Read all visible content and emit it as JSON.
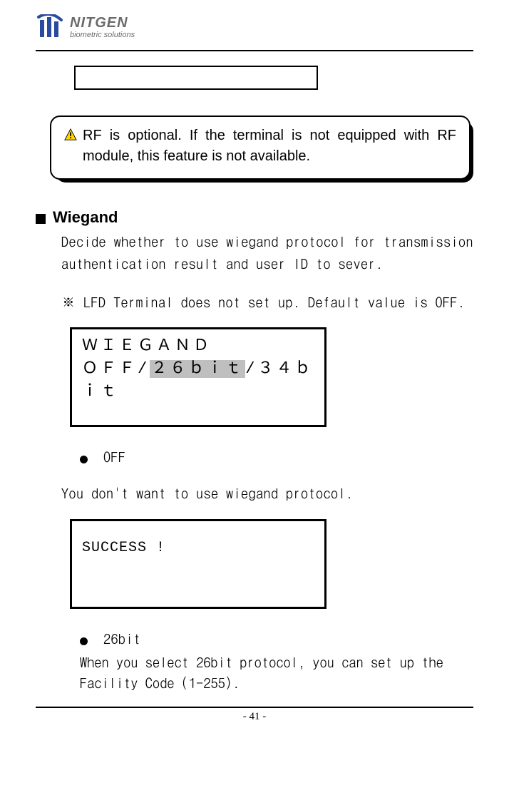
{
  "brand": {
    "primary": "NITGEN",
    "secondary": "biometric solutions"
  },
  "warning": {
    "text": "RF is optional. If the terminal is not equipped with RF module, this feature is not available."
  },
  "section": {
    "title": "Wiegand",
    "desc": "Decide whether to use wiegand protocol for transmission authentication result and user ID to sever.",
    "note": "※ LFD Terminal does not set up. Default value is OFF."
  },
  "lcd1": {
    "line1": "ＷＩＥＧＡＮＤ",
    "prefix": "ＯＦＦ/",
    "sel": "２６ｂｉｔ",
    "suffix": "/３４ｂｉｔ"
  },
  "opt_off": {
    "label": "OFF",
    "desc": "You don't want to use wiegand protocol."
  },
  "lcd2": {
    "line1": "SUCCESS !"
  },
  "opt_26": {
    "label": "26bit",
    "desc": "When you select 26bit protocol, you can set up the Facility Code (1-255)."
  },
  "footer": {
    "page": "- 41 -"
  }
}
